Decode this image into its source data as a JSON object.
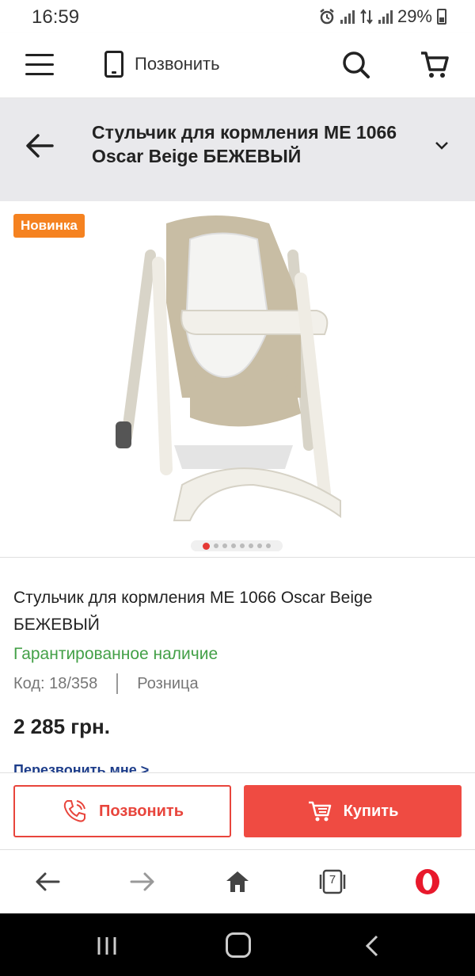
{
  "status_bar": {
    "time": "16:59",
    "battery": "29%"
  },
  "header": {
    "call_label": "Позвонить"
  },
  "title_bar": {
    "title": "Стульчик для кормления ME 1066 Oscar Beige БЕЖЕВЫЙ"
  },
  "gallery": {
    "badge": "Новинка",
    "image_count": 8,
    "active_index": 0
  },
  "product": {
    "name": "Стульчик для кормления ME 1066 Oscar Beige БЕЖЕВЫЙ",
    "availability": "Гарантированное наличие",
    "code": "Код: 18/358",
    "sale_type": "Розница",
    "price": "2 285 грн.",
    "callback_link": "Перезвонить мне >"
  },
  "actions": {
    "call_label": "Позвонить",
    "buy_label": "Купить"
  },
  "browser": {
    "tabs_count": "7"
  },
  "colors": {
    "accent_red": "#ef4b42",
    "badge_orange": "#f58220",
    "availability_green": "#43a047",
    "link_blue": "#1d3d8a"
  },
  "icons": [
    "alarm-icon",
    "signal-icon",
    "battery-icon",
    "menu-icon",
    "phone-icon",
    "search-icon",
    "cart-icon",
    "back-arrow-icon",
    "chevron-down-icon",
    "phone-call-icon",
    "cart-buy-icon",
    "browser-back-icon",
    "browser-forward-icon",
    "home-icon",
    "tabs-icon",
    "opera-icon",
    "recent-apps-icon",
    "system-home-icon",
    "system-back-icon"
  ]
}
